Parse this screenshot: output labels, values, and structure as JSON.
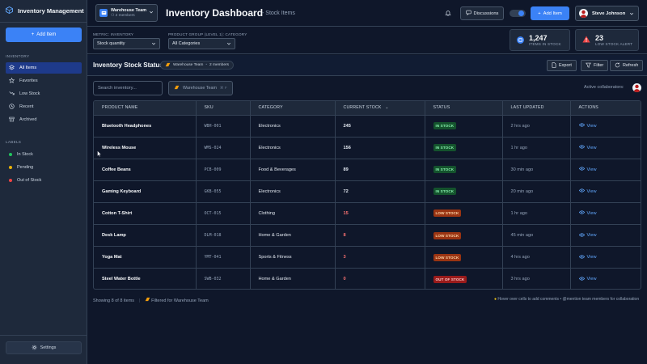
{
  "app": {
    "title": "Inventory Management"
  },
  "sidebar": {
    "add_label": "Add Item",
    "section_inventory": "INVENTORY",
    "items": [
      {
        "label": "All Items",
        "icon": "layers-icon",
        "active": true
      },
      {
        "label": "Favorites",
        "icon": "star-icon",
        "active": false
      },
      {
        "label": "Low Stock",
        "icon": "trend-down-icon",
        "active": false
      },
      {
        "label": "Recent",
        "icon": "clock-icon",
        "active": false
      },
      {
        "label": "Archived",
        "icon": "archive-icon",
        "active": false
      }
    ],
    "section_labels": "LABELS",
    "labels": [
      {
        "label": "In Stock",
        "color": "#22c55e"
      },
      {
        "label": "Pending",
        "color": "#eab308"
      },
      {
        "label": "Out of Stock",
        "color": "#ef4444"
      }
    ],
    "settings_label": "Settings"
  },
  "header": {
    "team_name": "Warehouse Team",
    "team_members": "2 members",
    "title": "Inventory Dashboard",
    "subtitle": "- Stock Items",
    "discussions_label": "Discussions",
    "add_label": "Add Item",
    "user_name": "Steve Johnson"
  },
  "filters": {
    "metric_label": "METRIC: INVENTORY",
    "metric_value": "Stock quantity",
    "group_label": "PRODUCT GROUP (LEVEL 1): CATEGORY",
    "group_value": "All Categories"
  },
  "stats": {
    "in_stock_value": "1,247",
    "in_stock_label": "ITEMS IN STOCK",
    "alert_value": "23",
    "alert_label": "LOW STOCK ALERT"
  },
  "list": {
    "title": "Inventory Stock Status",
    "team_pill": "Warehouse Team",
    "team_pill_members": "2 members",
    "export_label": "Export",
    "filter_label": "Filter",
    "refresh_label": "Refresh",
    "search_placeholder": "Search inventory...",
    "filter_chip": "Warehouse Team",
    "filter_chip_kbd": "⌘ F",
    "collab_label": "Active collaborators:"
  },
  "table": {
    "columns": [
      "PRODUCT NAME",
      "SKU",
      "CATEGORY",
      "CURRENT STOCK",
      "STATUS",
      "LAST UPDATED",
      "ACTIONS"
    ],
    "view_label": "View",
    "rows": [
      {
        "name": "Bluetooth Headphones",
        "sku": "WBH-001",
        "category": "Electronics",
        "stock": "245",
        "status": "IN STOCK",
        "status_type": "in",
        "updated": "2 hrs ago"
      },
      {
        "name": "Wireless Mouse",
        "sku": "WMS-024",
        "category": "Electronics",
        "stock": "156",
        "status": "IN STOCK",
        "status_type": "in",
        "updated": "1 hr ago"
      },
      {
        "name": "Coffee Beans",
        "sku": "PCB-009",
        "category": "Food & Beverages",
        "stock": "89",
        "status": "IN STOCK",
        "status_type": "in",
        "updated": "30 min ago"
      },
      {
        "name": "Gaming Keyboard",
        "sku": "GKB-055",
        "category": "Electronics",
        "stock": "72",
        "status": "IN STOCK",
        "status_type": "in",
        "updated": "20 min ago"
      },
      {
        "name": "Cotton T-Shirt",
        "sku": "OCT-015",
        "category": "Clothing",
        "stock": "15",
        "status": "LOW STOCK",
        "status_type": "low",
        "updated": "1 hr ago"
      },
      {
        "name": "Desk Lamp",
        "sku": "DLM-018",
        "category": "Home & Garden",
        "stock": "8",
        "status": "LOW STOCK",
        "status_type": "low",
        "updated": "45 min ago"
      },
      {
        "name": "Yoga Mat",
        "sku": "YMT-041",
        "category": "Sports & Fitness",
        "stock": "3",
        "status": "LOW STOCK",
        "status_type": "low",
        "updated": "4 hrs ago"
      },
      {
        "name": "Steel Water Bottle",
        "sku": "SWB-032",
        "category": "Home & Garden",
        "stock": "0",
        "status": "OUT OF STOCK",
        "status_type": "out",
        "updated": "3 hrs ago"
      }
    ]
  },
  "footer": {
    "showing": "Showing 8 of 8 items",
    "filtered": "Filtered for Warehouse Team",
    "hint": "Hover over cells to add comments • @mention team members for collaboration"
  },
  "colors": {
    "accent": "#3b82f6",
    "in_stock_bg": "#14532d",
    "in_stock_fg": "#86efac",
    "low_stock_bg": "#9a3412",
    "low_stock_fg": "#fed7aa",
    "out_stock_bg": "#991b1b",
    "out_stock_fg": "#fecaca",
    "stock_warn": "#f87171"
  }
}
